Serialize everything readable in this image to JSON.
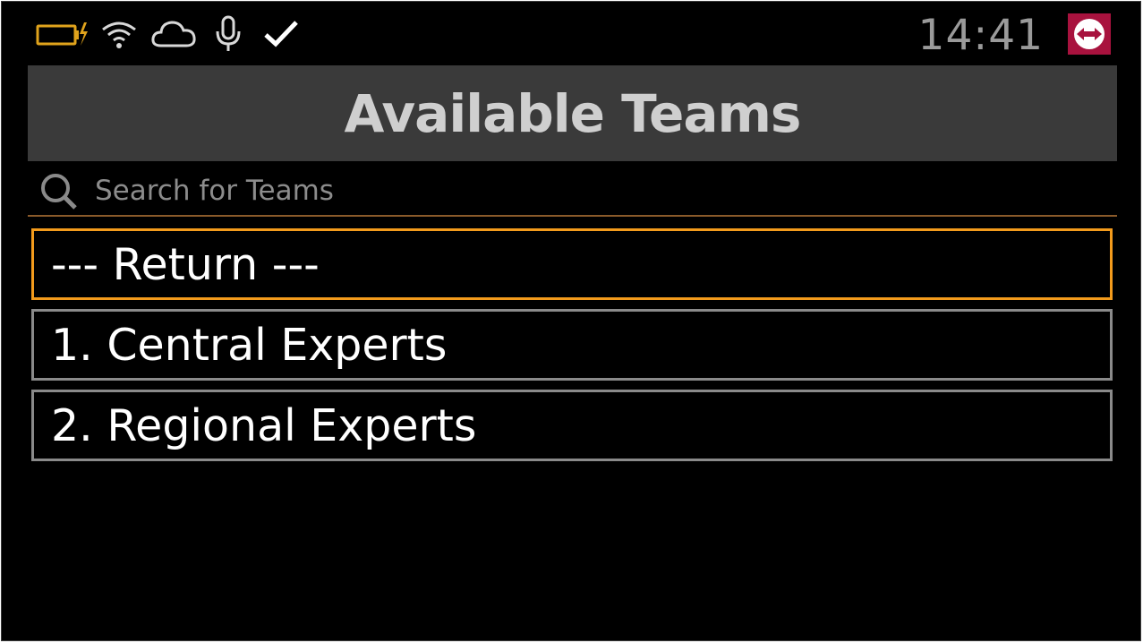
{
  "status_bar": {
    "icons": [
      "battery-charging-icon",
      "wifi-icon",
      "cloud-icon",
      "microphone-icon",
      "checkmark-icon"
    ],
    "time": "14:41",
    "app_logo": "teamviewer-logo-icon"
  },
  "header": {
    "title": "Available Teams"
  },
  "search": {
    "placeholder": "Search for Teams",
    "value": ""
  },
  "teams": {
    "items": [
      {
        "label": "--- Return ---",
        "selected": true
      },
      {
        "label": "1. Central Experts",
        "selected": false
      },
      {
        "label": "2. Regional Experts",
        "selected": false
      }
    ]
  },
  "colors": {
    "background": "#000000",
    "title_bar": "#3a3a3a",
    "title_text": "#cfcfcf",
    "selection_border": "#f39b1c",
    "item_border": "#8a8a8a",
    "search_underline": "#8a5a2a",
    "battery": "#e0a31c",
    "logo_bg": "#a8123e"
  }
}
